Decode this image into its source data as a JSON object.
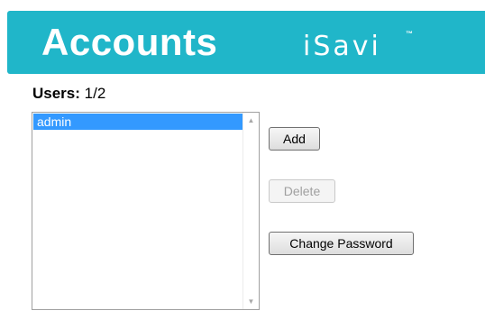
{
  "header": {
    "title": "Accounts",
    "brand": "iSavi",
    "brand_tm": "™",
    "background_color": "#20b6c9"
  },
  "users": {
    "label": "Users:",
    "count": "1/2",
    "items": [
      {
        "name": "admin",
        "selected": true
      }
    ]
  },
  "scrollbar": {
    "up_icon": "scroll-up-arrow",
    "down_icon": "scroll-down-arrow"
  },
  "buttons": {
    "add": {
      "label": "Add",
      "enabled": true
    },
    "delete": {
      "label": "Delete",
      "enabled": false
    },
    "change_password": {
      "label": "Change Password",
      "enabled": true
    }
  },
  "colors": {
    "selection": "#3399ff"
  }
}
